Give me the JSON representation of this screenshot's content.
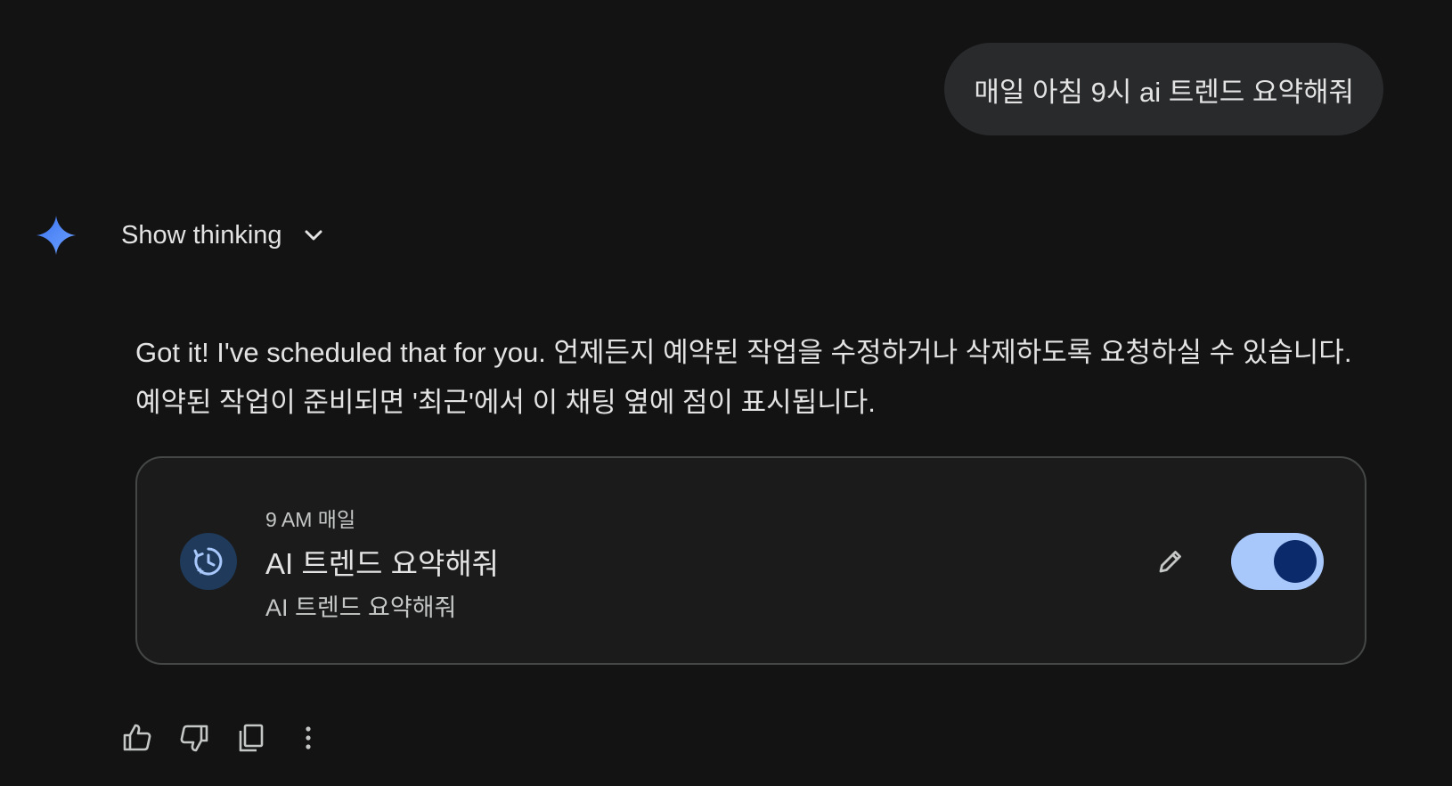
{
  "user_message": "매일 아침 9시 ai 트렌드 요약해줘",
  "assistant": {
    "show_thinking_label": "Show thinking",
    "response_line1": "Got it! I've scheduled that for you. 언제든지 예약된 작업을 수정하거나 삭제하도록 요청하실 수 있습니다.",
    "response_line2": "예약된 작업이 준비되면 '최근'에서 이 채팅 옆에 점이 표시됩니다."
  },
  "scheduled_task": {
    "time": "9 AM 매일",
    "title": "AI 트렌드 요약해줘",
    "subtitle": "AI 트렌드 요약해줘",
    "enabled": true
  },
  "actions": [
    "thumbs-up-icon",
    "thumbs-down-icon",
    "copy-icon",
    "more-vert-icon"
  ],
  "colors": {
    "background": "#131314",
    "bubble": "#282a2c",
    "toggle_track": "#a8c7fa",
    "toggle_knob": "#0b2a6b",
    "spark_blue": "#4285f4"
  }
}
